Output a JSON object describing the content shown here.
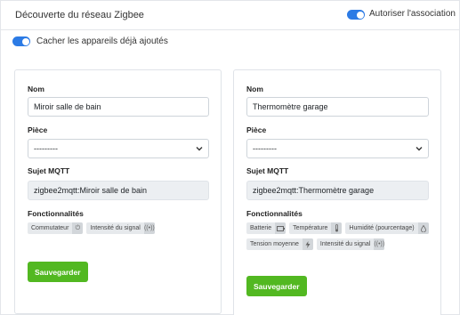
{
  "header": {
    "title": "Découverte du réseau Zigbee",
    "allow_association_label": "Autoriser l'association"
  },
  "filter": {
    "hide_added_label": "Cacher les appareils déjà ajoutés"
  },
  "labels": {
    "name": "Nom",
    "room": "Pièce",
    "mqtt_topic": "Sujet MQTT",
    "features": "Fonctionnalités",
    "save": "Sauvegarder"
  },
  "devices": [
    {
      "name": "Miroir salle de bain",
      "room": "---------",
      "mqtt_topic": "zigbee2mqtt:Miroir salle de bain",
      "features": [
        {
          "label": "Commutateur",
          "icon": "power-icon"
        },
        {
          "label": "Intensité du signal",
          "icon": "signal-icon"
        }
      ]
    },
    {
      "name": "Thermomètre garage",
      "room": "---------",
      "mqtt_topic": "zigbee2mqtt:Thermomètre garage",
      "features": [
        {
          "label": "Batterie",
          "icon": "battery-icon"
        },
        {
          "label": "Température",
          "icon": "thermometer-icon"
        },
        {
          "label": "Humidité (pourcentage)",
          "icon": "droplet-icon"
        },
        {
          "label": "Tension moyenne",
          "icon": "lightning-icon"
        },
        {
          "label": "Intensité du signal",
          "icon": "signal-icon"
        }
      ]
    }
  ],
  "colors": {
    "toggle": "#2c7be5",
    "save_button": "#52b821"
  }
}
